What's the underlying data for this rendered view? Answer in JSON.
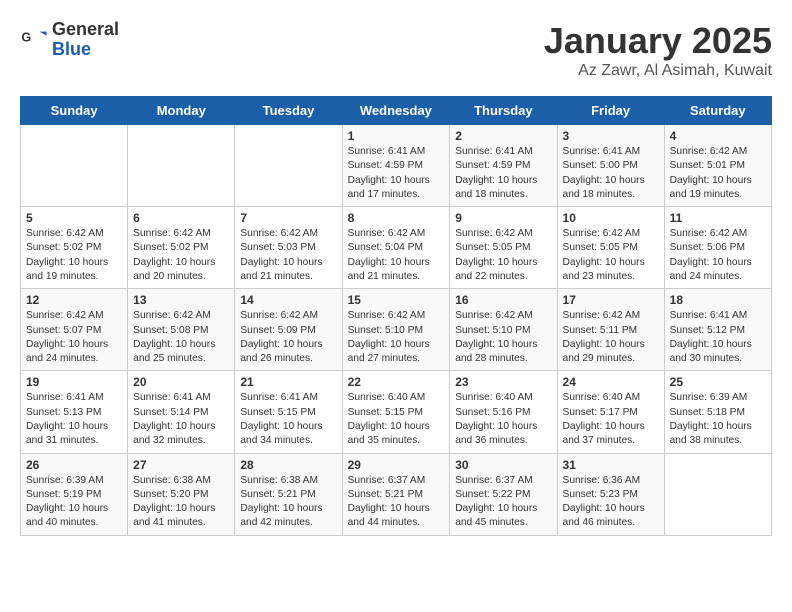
{
  "header": {
    "logo_line1": "General",
    "logo_line2": "Blue",
    "title": "January 2025",
    "subtitle": "Az Zawr, Al Asimah, Kuwait"
  },
  "days_of_week": [
    "Sunday",
    "Monday",
    "Tuesday",
    "Wednesday",
    "Thursday",
    "Friday",
    "Saturday"
  ],
  "weeks": [
    [
      {
        "day": "",
        "content": ""
      },
      {
        "day": "",
        "content": ""
      },
      {
        "day": "",
        "content": ""
      },
      {
        "day": "1",
        "content": "Sunrise: 6:41 AM\nSunset: 4:59 PM\nDaylight: 10 hours and 17 minutes."
      },
      {
        "day": "2",
        "content": "Sunrise: 6:41 AM\nSunset: 4:59 PM\nDaylight: 10 hours and 18 minutes."
      },
      {
        "day": "3",
        "content": "Sunrise: 6:41 AM\nSunset: 5:00 PM\nDaylight: 10 hours and 18 minutes."
      },
      {
        "day": "4",
        "content": "Sunrise: 6:42 AM\nSunset: 5:01 PM\nDaylight: 10 hours and 19 minutes."
      }
    ],
    [
      {
        "day": "5",
        "content": "Sunrise: 6:42 AM\nSunset: 5:02 PM\nDaylight: 10 hours and 19 minutes."
      },
      {
        "day": "6",
        "content": "Sunrise: 6:42 AM\nSunset: 5:02 PM\nDaylight: 10 hours and 20 minutes."
      },
      {
        "day": "7",
        "content": "Sunrise: 6:42 AM\nSunset: 5:03 PM\nDaylight: 10 hours and 21 minutes."
      },
      {
        "day": "8",
        "content": "Sunrise: 6:42 AM\nSunset: 5:04 PM\nDaylight: 10 hours and 21 minutes."
      },
      {
        "day": "9",
        "content": "Sunrise: 6:42 AM\nSunset: 5:05 PM\nDaylight: 10 hours and 22 minutes."
      },
      {
        "day": "10",
        "content": "Sunrise: 6:42 AM\nSunset: 5:05 PM\nDaylight: 10 hours and 23 minutes."
      },
      {
        "day": "11",
        "content": "Sunrise: 6:42 AM\nSunset: 5:06 PM\nDaylight: 10 hours and 24 minutes."
      }
    ],
    [
      {
        "day": "12",
        "content": "Sunrise: 6:42 AM\nSunset: 5:07 PM\nDaylight: 10 hours and 24 minutes."
      },
      {
        "day": "13",
        "content": "Sunrise: 6:42 AM\nSunset: 5:08 PM\nDaylight: 10 hours and 25 minutes."
      },
      {
        "day": "14",
        "content": "Sunrise: 6:42 AM\nSunset: 5:09 PM\nDaylight: 10 hours and 26 minutes."
      },
      {
        "day": "15",
        "content": "Sunrise: 6:42 AM\nSunset: 5:10 PM\nDaylight: 10 hours and 27 minutes."
      },
      {
        "day": "16",
        "content": "Sunrise: 6:42 AM\nSunset: 5:10 PM\nDaylight: 10 hours and 28 minutes."
      },
      {
        "day": "17",
        "content": "Sunrise: 6:42 AM\nSunset: 5:11 PM\nDaylight: 10 hours and 29 minutes."
      },
      {
        "day": "18",
        "content": "Sunrise: 6:41 AM\nSunset: 5:12 PM\nDaylight: 10 hours and 30 minutes."
      }
    ],
    [
      {
        "day": "19",
        "content": "Sunrise: 6:41 AM\nSunset: 5:13 PM\nDaylight: 10 hours and 31 minutes."
      },
      {
        "day": "20",
        "content": "Sunrise: 6:41 AM\nSunset: 5:14 PM\nDaylight: 10 hours and 32 minutes."
      },
      {
        "day": "21",
        "content": "Sunrise: 6:41 AM\nSunset: 5:15 PM\nDaylight: 10 hours and 34 minutes."
      },
      {
        "day": "22",
        "content": "Sunrise: 6:40 AM\nSunset: 5:15 PM\nDaylight: 10 hours and 35 minutes."
      },
      {
        "day": "23",
        "content": "Sunrise: 6:40 AM\nSunset: 5:16 PM\nDaylight: 10 hours and 36 minutes."
      },
      {
        "day": "24",
        "content": "Sunrise: 6:40 AM\nSunset: 5:17 PM\nDaylight: 10 hours and 37 minutes."
      },
      {
        "day": "25",
        "content": "Sunrise: 6:39 AM\nSunset: 5:18 PM\nDaylight: 10 hours and 38 minutes."
      }
    ],
    [
      {
        "day": "26",
        "content": "Sunrise: 6:39 AM\nSunset: 5:19 PM\nDaylight: 10 hours and 40 minutes."
      },
      {
        "day": "27",
        "content": "Sunrise: 6:38 AM\nSunset: 5:20 PM\nDaylight: 10 hours and 41 minutes."
      },
      {
        "day": "28",
        "content": "Sunrise: 6:38 AM\nSunset: 5:21 PM\nDaylight: 10 hours and 42 minutes."
      },
      {
        "day": "29",
        "content": "Sunrise: 6:37 AM\nSunset: 5:21 PM\nDaylight: 10 hours and 44 minutes."
      },
      {
        "day": "30",
        "content": "Sunrise: 6:37 AM\nSunset: 5:22 PM\nDaylight: 10 hours and 45 minutes."
      },
      {
        "day": "31",
        "content": "Sunrise: 6:36 AM\nSunset: 5:23 PM\nDaylight: 10 hours and 46 minutes."
      },
      {
        "day": "",
        "content": ""
      }
    ]
  ]
}
